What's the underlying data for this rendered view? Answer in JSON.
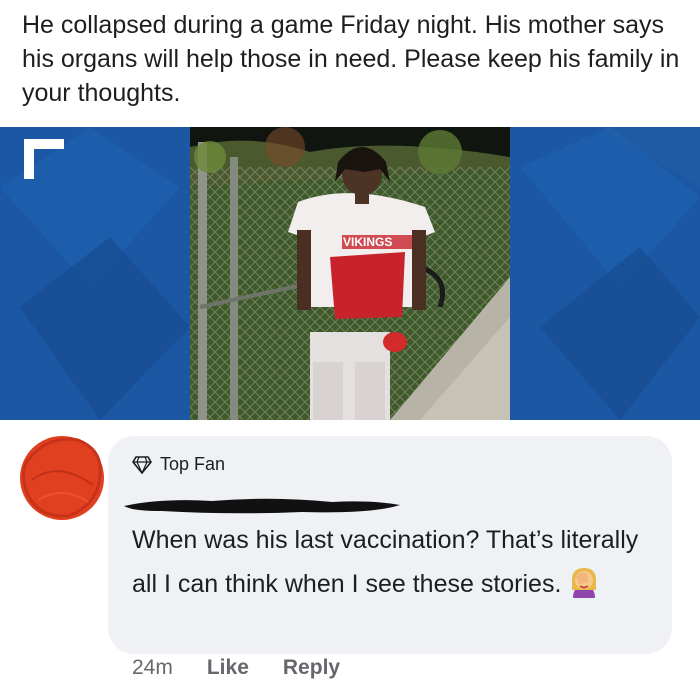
{
  "post": {
    "caption": "He collapsed during a game Friday night. His mother says his organs will help those in need. Please keep his family in your thoughts.",
    "media": {
      "jersey_text": "VIKINGS"
    }
  },
  "comment": {
    "badge": "Top Fan",
    "badge_icon": "diamond-icon",
    "text": "When was his last vaccination? That’s literally all I can think when I see these stories.",
    "emoji": "face-palm-emoji",
    "timestamp": "24m",
    "like_label": "Like",
    "reply_label": "Reply"
  },
  "colors": {
    "media_background": "#1b57a3",
    "bubble": "#eff1f4",
    "meta_text": "#65676b",
    "avatar_scribble": "#e0401f"
  }
}
